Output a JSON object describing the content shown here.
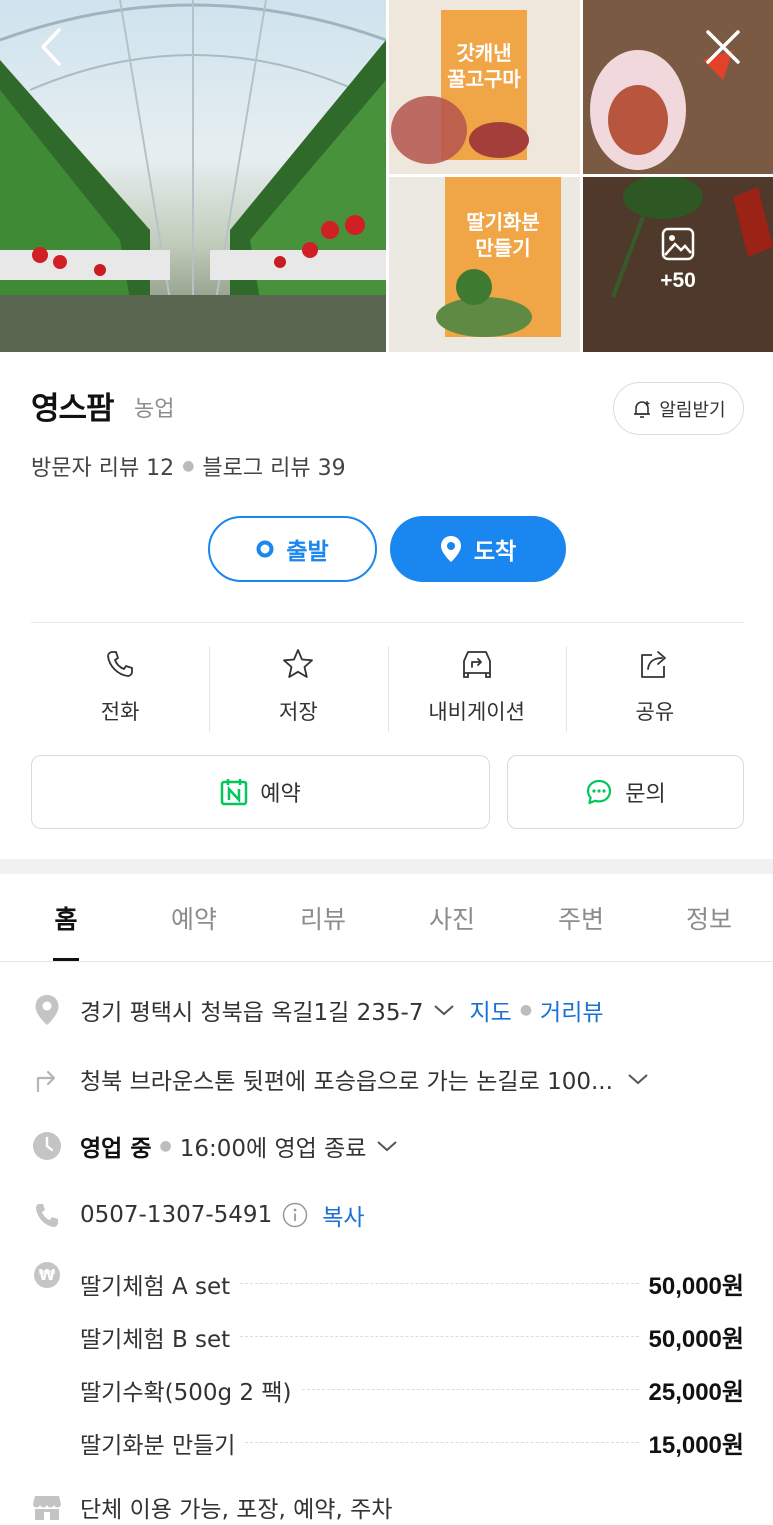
{
  "gallery": {
    "sign_1": "갓캐낸\n꿀고구마",
    "sign_2": "딸기화분\n만들기",
    "more_count": "+50"
  },
  "place": {
    "name": "영스팜",
    "category": "농업",
    "alert_label": "알림받기",
    "visitor_reviews": "방문자 리뷰 12",
    "blog_reviews": "블로그 리뷰 39"
  },
  "route": {
    "start_label": "출발",
    "end_label": "도착"
  },
  "actions": [
    {
      "label": "전화",
      "icon": "phone-icon"
    },
    {
      "label": "저장",
      "icon": "star-icon"
    },
    {
      "label": "내비게이션",
      "icon": "navigation-icon"
    },
    {
      "label": "공유",
      "icon": "share-icon"
    }
  ],
  "cta": {
    "reserve_label": "예약",
    "inquiry_label": "문의"
  },
  "tabs": [
    "홈",
    "예약",
    "리뷰",
    "사진",
    "주변",
    "정보"
  ],
  "info": {
    "address": "경기 평택시 청북읍 옥길1길 235-7",
    "map_link": "지도",
    "street_view_link": "거리뷰",
    "directions": "청북 브라운스톤 뒷편에 포승읍으로 가는 논길로 100...",
    "status": "영업 중",
    "hours": "16:00에 영업 종료",
    "phone": "0507-1307-5491",
    "copy_label": "복사",
    "amenities": "단체 이용 가능, 포장, 예약, 주차"
  },
  "menu": [
    {
      "name": "딸기체험 A set",
      "price": "50,000원"
    },
    {
      "name": "딸기체험 B set",
      "price": "50,000원"
    },
    {
      "name": "딸기수확(500g 2 팩)",
      "price": "25,000원"
    },
    {
      "name": "딸기화분 만들기",
      "price": "15,000원"
    }
  ],
  "colors": {
    "accent": "#1a86f0",
    "link": "#1a70d6",
    "naver_green": "#03c75a"
  }
}
